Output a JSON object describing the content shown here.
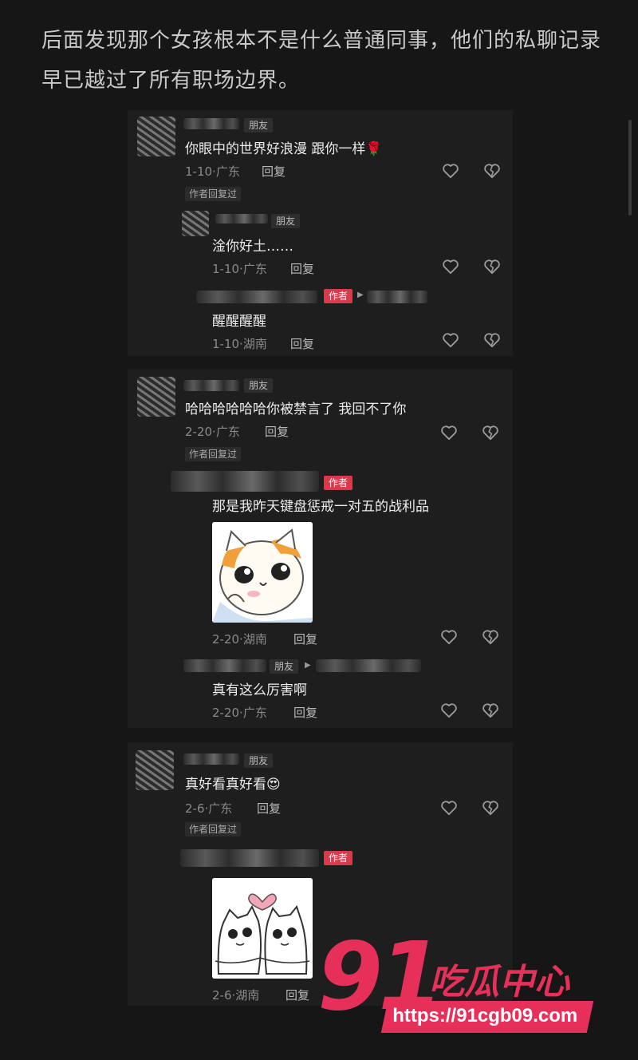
{
  "intro_text": "后面发现那个女孩根本不是什么普通同事，他们的私聊记录早已越过了所有职场边界。",
  "tags": {
    "friend": "朋友",
    "author": "作者"
  },
  "reply_label": "回复",
  "author_replied_badge": "作者回复过",
  "thread1": {
    "main": {
      "text": "你眼中的世界好浪漫  跟你一样",
      "emoji": "🌹",
      "date": "1-10",
      "location": "广东"
    },
    "replies": [
      {
        "text": "淦你好土……",
        "date": "1-10",
        "location": "广东"
      },
      {
        "text": "醒醒醒醒",
        "date": "1-10",
        "location": "湖南"
      }
    ]
  },
  "thread2": {
    "main": {
      "text": "哈哈哈哈哈哈你被禁言了 我回不了你",
      "date": "2-20",
      "location": "广东"
    },
    "replies": [
      {
        "text": "那是我昨天键盘惩戒一对五的战利品",
        "date": "2-20",
        "location": "湖南"
      },
      {
        "text": "真有这么厉害啊",
        "date": "2-20",
        "location": "广东"
      }
    ]
  },
  "thread3": {
    "main": {
      "text": "真好看真好看",
      "emoji": "😍",
      "date": "2-6",
      "location": "广东"
    },
    "replies": [
      {
        "date": "2-6",
        "location": "湖南"
      }
    ]
  },
  "watermark": {
    "number": "91",
    "name": "吃瓜中心",
    "url": "https://91cgb09.com"
  },
  "colors": {
    "author_tag": "#d83a4c",
    "watermark": "#e6305a",
    "background": "#161616"
  },
  "icons": [
    "heart-outline-icon",
    "broken-heart-icon"
  ]
}
